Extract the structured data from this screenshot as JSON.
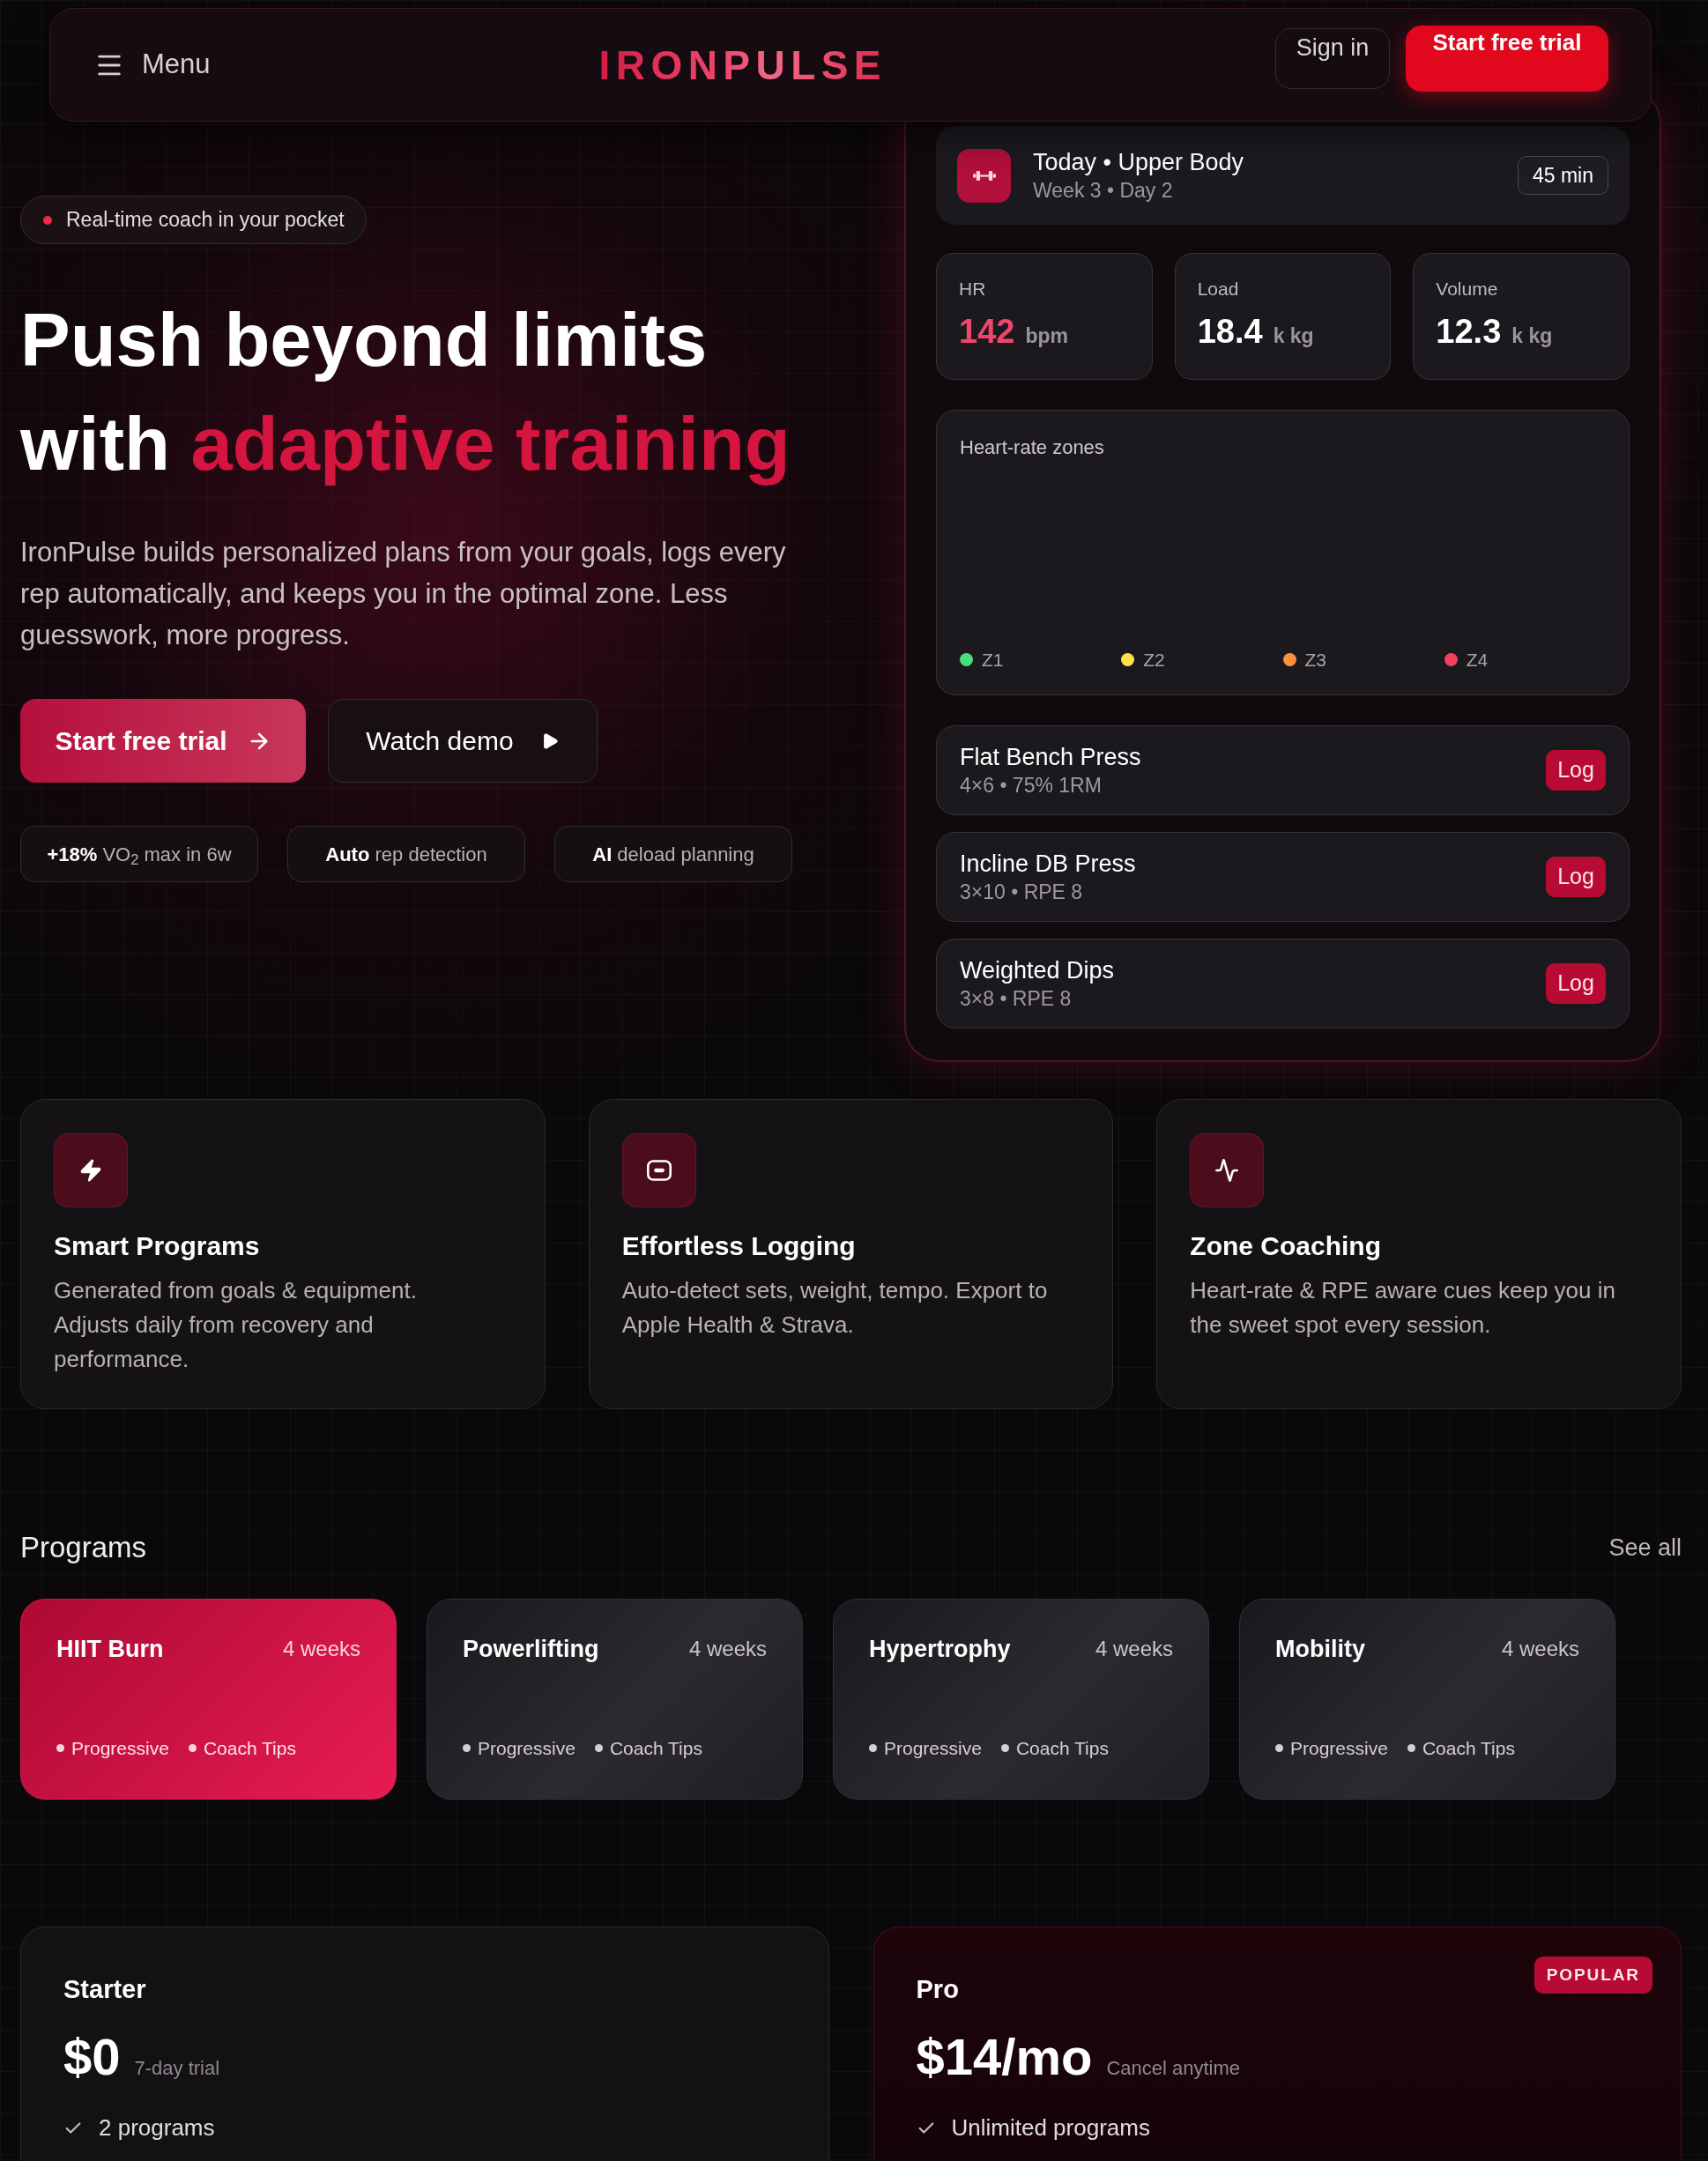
{
  "header": {
    "menu_label": "Menu",
    "logo": "IRONPULSE",
    "sign_in": "Sign in",
    "cta": "Start free trial"
  },
  "hero": {
    "badge": "Real-time coach in your pocket",
    "heading": "Push beyond limits with",
    "heading_highlight": "adaptive training",
    "description": "IronPulse builds personalized plans from your goals, logs every rep automatically, and keeps you in the optimal zone. Less guesswork, more progress.",
    "primary_button": "Start free trial",
    "secondary_button": "Watch demo",
    "highlights": [
      "**+18%** VO$_{2}$ max in 6w",
      "**Auto** rep detection",
      "**AI** deload planning"
    ]
  },
  "workout_panel": {
    "today": {
      "title": "Today • Upper Body",
      "subtitle": "Week 3 • Day 2",
      "duration": "45 min"
    },
    "stats": [
      {
        "label": "HR",
        "value": "142",
        "unit": "bpm",
        "highlight": true
      },
      {
        "label": "Load",
        "value": "18.4",
        "unit": "k kg",
        "highlight": false
      },
      {
        "label": "Volume",
        "value": "12.3",
        "unit": "k kg",
        "highlight": false
      }
    ],
    "zones": {
      "title": "Heart-rate zones",
      "legend": [
        {
          "label": "Z1",
          "color": "#4ade80"
        },
        {
          "label": "Z2",
          "color": "#fde047"
        },
        {
          "label": "Z3",
          "color": "#fb923c"
        },
        {
          "label": "Z4",
          "color": "#f43f5e"
        }
      ]
    },
    "exercises": [
      {
        "name": "Flat Bench Press",
        "detail": "4×6 • 75% 1RM",
        "action": "Log"
      },
      {
        "name": "Incline DB Press",
        "detail": "3×10 • RPE 8",
        "action": "Log"
      },
      {
        "name": "Weighted Dips",
        "detail": "3×8 • RPE 8",
        "action": "Log"
      }
    ]
  },
  "features": [
    {
      "title": "Smart Programs",
      "description": "Generated from goals & equipment. Adjusts daily from recovery and performance."
    },
    {
      "title": "Effortless Logging",
      "description": "Auto-detect sets, weight, tempo. Export to Apple Health & Strava."
    },
    {
      "title": "Zone Coaching",
      "description": "Heart-rate & RPE aware cues keep you in the sweet spot every session."
    }
  ],
  "programs": {
    "title": "Programs",
    "see_all": "See all",
    "items": [
      {
        "name": "HIIT Burn",
        "duration": "4 weeks",
        "tags": [
          "Progressive",
          "Coach Tips"
        ],
        "selected": true
      },
      {
        "name": "Powerlifting",
        "duration": "4 weeks",
        "tags": [
          "Progressive",
          "Coach Tips"
        ],
        "selected": false
      },
      {
        "name": "Hypertrophy",
        "duration": "4 weeks",
        "tags": [
          "Progressive",
          "Coach Tips"
        ],
        "selected": false
      },
      {
        "name": "Mobility",
        "duration": "4 weeks",
        "tags": [
          "Progressive",
          "Coach Tips"
        ],
        "selected": false
      }
    ]
  },
  "pricing": [
    {
      "name": "Starter",
      "price": "$0",
      "note": "7-day trial",
      "features": [
        "2 programs"
      ],
      "popular": false
    },
    {
      "name": "Pro",
      "price": "$14/mo",
      "note": "Cancel anytime",
      "features": [
        "Unlimited programs"
      ],
      "popular": true,
      "badge": "POPULAR"
    }
  ]
}
